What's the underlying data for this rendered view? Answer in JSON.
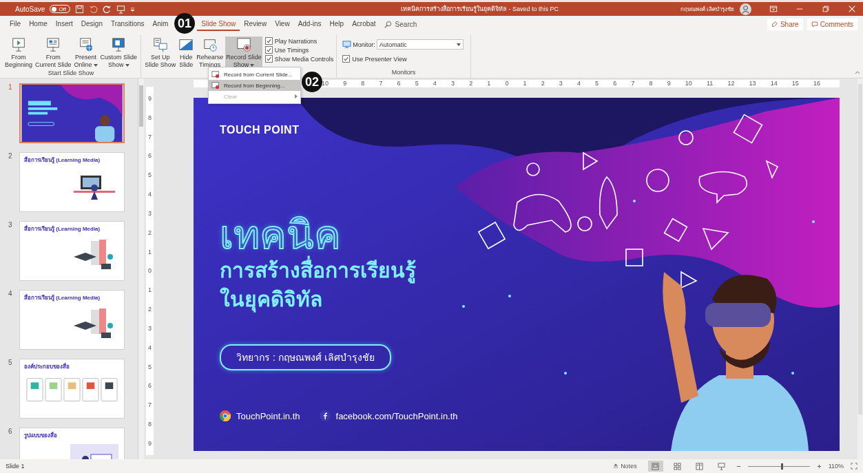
{
  "title_bar": {
    "autosave": {
      "label": "AutoSave",
      "toggle_text": "Off",
      "on": false
    },
    "title": "เทคนิคการสร้างสื่อการเรียนรู้ในยุคดิจิทัล  -  Saved to this PC",
    "user": "กฤษณพงศ์ เลิศบำรุงชัย"
  },
  "tabs": [
    {
      "label": "File",
      "selected": false
    },
    {
      "label": "Home",
      "selected": false
    },
    {
      "label": "Insert",
      "selected": false
    },
    {
      "label": "Design",
      "selected": false
    },
    {
      "label": "Transitions",
      "selected": false
    },
    {
      "label": "Anim",
      "selected": false
    },
    {
      "label": "Slide Show",
      "selected": true
    },
    {
      "label": "Review",
      "selected": false
    },
    {
      "label": "View",
      "selected": false
    },
    {
      "label": "Add-ins",
      "selected": false
    },
    {
      "label": "Help",
      "selected": false
    },
    {
      "label": "Acrobat",
      "selected": false
    }
  ],
  "search": {
    "label": "Search"
  },
  "share": "Share",
  "comments": "Comments",
  "ribbon": {
    "groups": [
      {
        "label": "Start Slide Show",
        "items": [
          {
            "kind": "large",
            "lines": [
              "From",
              "Beginning"
            ],
            "has_menu": false,
            "pressed": false
          },
          {
            "kind": "large",
            "lines": [
              "From",
              "Current Slide"
            ],
            "has_menu": false,
            "pressed": false
          },
          {
            "kind": "large",
            "lines": [
              "Present",
              "Online"
            ],
            "has_menu": true,
            "pressed": false
          },
          {
            "kind": "large",
            "lines": [
              "Custom Slide",
              "Show"
            ],
            "has_menu": true,
            "pressed": false
          }
        ]
      },
      {
        "items": [
          {
            "kind": "large",
            "lines": [
              "Set Up",
              "Slide Show"
            ],
            "has_menu": false,
            "pressed": false
          },
          {
            "kind": "large",
            "lines": [
              "Hide",
              "Slide"
            ],
            "has_menu": false,
            "pressed": false
          },
          {
            "kind": "large",
            "lines": [
              "Rehearse",
              "Timings"
            ],
            "has_menu": false,
            "pressed": false
          },
          {
            "kind": "large",
            "lines": [
              "Record Slide",
              "Show"
            ],
            "has_menu": true,
            "pressed": true
          },
          {
            "kind": "checks",
            "checks": [
              {
                "label": "Play Narrations",
                "checked": true
              },
              {
                "label": "Use Timings",
                "checked": true
              },
              {
                "label": "Show Media Controls",
                "checked": true
              }
            ]
          }
        ]
      },
      {
        "label": "Monitors",
        "items": [
          {
            "kind": "monitor",
            "label": "Monitor:",
            "value": "Automatic",
            "checks": [
              {
                "label": "Use Presenter View",
                "checked": true
              }
            ]
          }
        ]
      }
    ]
  },
  "record_menu": [
    {
      "label": "Record from Current Slide...",
      "selected": false,
      "disabled": false,
      "submenu": false
    },
    {
      "label": "Record from Beginning...",
      "selected": true,
      "disabled": false,
      "submenu": false
    },
    {
      "label": "Clear",
      "selected": false,
      "disabled": true,
      "submenu": true
    }
  ],
  "callouts": [
    {
      "text": "01"
    },
    {
      "text": "02"
    }
  ],
  "thumbnails": [
    {
      "number": "1",
      "selected": true,
      "kind": "title"
    },
    {
      "number": "2",
      "selected": false,
      "kind": "desk",
      "heading": "สื่อการเรียนรู้ (Learning Media)"
    },
    {
      "number": "3",
      "selected": false,
      "kind": "books",
      "heading": "สื่อการเรียนรู้ (Learning Media)"
    },
    {
      "number": "4",
      "selected": false,
      "kind": "books",
      "heading": "สื่อการเรียนรู้ (Learning Media)"
    },
    {
      "number": "5",
      "selected": false,
      "kind": "cards",
      "heading": "องค์ประกอบของสื่อ"
    },
    {
      "number": "6",
      "selected": false,
      "kind": "laptop",
      "heading": "รูปแบบของสื่อ"
    }
  ],
  "rulers": {
    "horizontal": [
      "10",
      "9",
      "8",
      "7",
      "6",
      "5",
      "4",
      "3",
      "2",
      "1",
      "0",
      "1",
      "2",
      "3",
      "4",
      "5",
      "6",
      "7",
      "8",
      "9",
      "10",
      "11",
      "12",
      "13",
      "14",
      "15",
      "16"
    ],
    "vertical": [
      "9",
      "8",
      "7",
      "6",
      "5",
      "4",
      "3",
      "2",
      "1",
      "0",
      "1",
      "2",
      "3",
      "4",
      "5",
      "6",
      "7",
      "8",
      "9"
    ]
  },
  "slide": {
    "logo": "TOUCH POINT",
    "headline": "เทคนิค",
    "subtitle_lines": [
      "การสร้างสื่อการเรียนรู้",
      "ในยุคดิจิทัล"
    ],
    "speaker": "วิทยากร : กฤษณพงศ์ เลิศบำรุงชัย",
    "links": [
      {
        "kind": "web",
        "text": "TouchPoint.in.th"
      },
      {
        "kind": "facebook",
        "text": "facebook.com/TouchPoint.in.th"
      }
    ]
  },
  "status_bar": {
    "slide_info": "Slide 1",
    "notes": "Notes",
    "views": [
      {
        "selected": true
      },
      {
        "selected": false
      },
      {
        "selected": false
      },
      {
        "selected": false
      }
    ],
    "zoom": {
      "level": 0.55
    },
    "zoom_text": "110%"
  }
}
